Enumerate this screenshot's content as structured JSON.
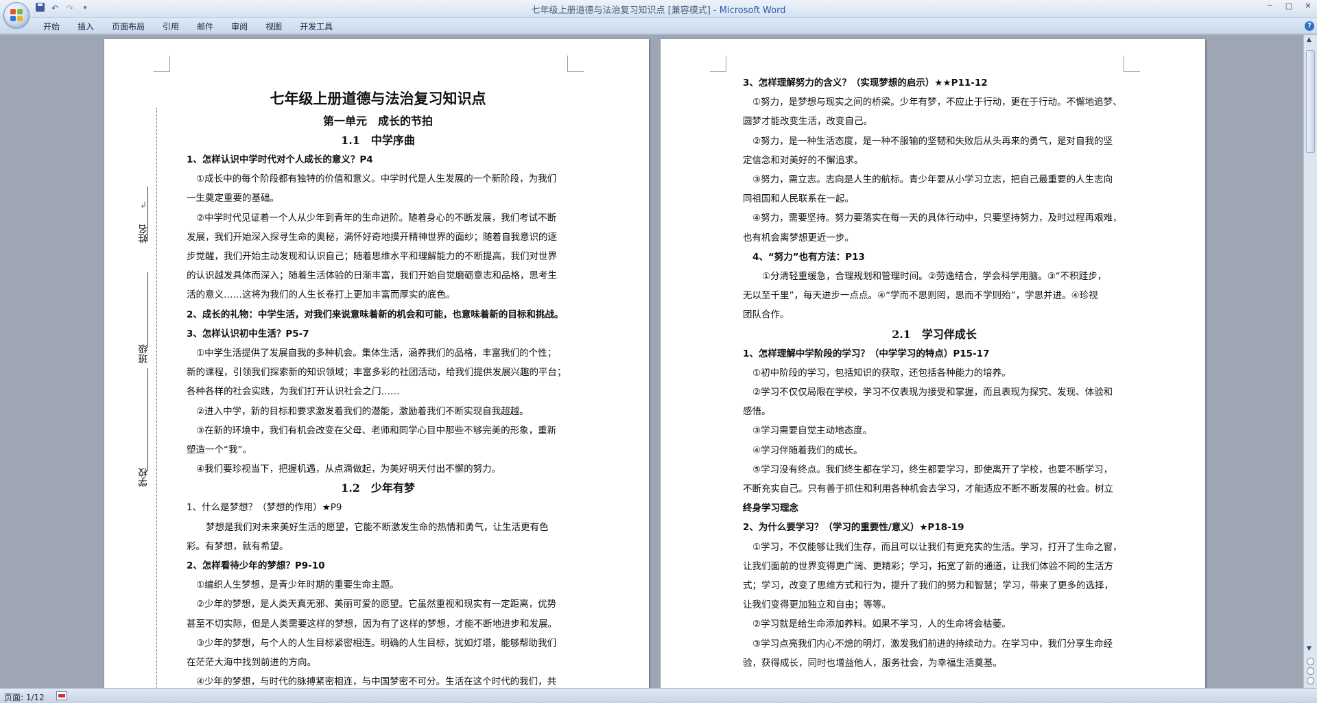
{
  "window": {
    "title": "七年级上册道德与法治复习知识点 [兼容模式] - ",
    "app_name": "Microsoft Word"
  },
  "qat": {
    "icons": [
      "save-icon",
      "undo-icon",
      "redo-icon",
      "customize-icon"
    ]
  },
  "ribbon": {
    "tabs": [
      "开始",
      "插入",
      "页面布局",
      "引用",
      "邮件",
      "审阅",
      "视图",
      "开发工具"
    ]
  },
  "page1": {
    "title": "七年级上册道德与法治复习知识点",
    "unit": "第一单元　成长的节拍",
    "sec1": "1.1　中学序曲",
    "lines1": [
      "1、怎样认识中学时代对个人成长的意义？P4",
      "①成长中的每个阶段都有独特的价值和意义。中学时代是人生发展的一个新阶段，为我们",
      "一生奠定重要的基础。",
      "②中学时代见证着一个人从少年到青年的生命进阶。随着身心的不断发展，我们考试不断",
      "发展，我们开始深入探寻生命的奥秘，满怀好奇地摸开精神世界的面纱；随着自我意识的逐",
      "步觉醒，我们开始主动发现和认识自己；随着思维水平和理解能力的不断提高，我们对世界",
      "的认识越发具体而深入；随着生活体验的日渐丰富，我们开始自觉磨砺意志和品格，思考生",
      "活的意义……这将为我们的人生长卷打上更加丰富而厚实的底色。",
      "2、成长的礼物：中学生活，对我们来说意味着新的机会和可能，也意味着新的目标和挑战。",
      "3、怎样认识初中生活？P5-7",
      "①中学生活提供了发展自我的多种机会。集体生活，涵养我们的品格，丰富我们的个性；",
      "新的课程，引领我们探索新的知识领域；丰富多彩的社团活动，给我们提供发展兴趣的平台；",
      "各种各样的社会实践，为我们打开认识社会之门……",
      "②进入中学，新的目标和要求激发着我们的潜能，激励着我们不断实现自我超越。",
      "③在新的环境中，我们有机会改变在父母、老师和同学心目中那些不够完美的形象，重新",
      "塑造一个“我”。",
      "④我们要珍视当下，把握机遇，从点滴做起，为美好明天付出不懈的努力。"
    ],
    "sec2": "1.2　少年有梦",
    "lines2": [
      "1、什么是梦想？（梦想的作用）★P9",
      "梦想是我们对未来美好生活的愿望，它能不断激发生命的热情和勇气，让生活更有色",
      "彩。有梦想，就有希望。",
      "2、怎样看待少年的梦想？P9-10",
      "①编织人生梦想，是青少年时期的重要生命主题。",
      "②少年的梦想，是人类天真无邪、美丽可爱的愿望。它虽然重视和现实有一定距离，优势",
      "甚至不切实际，但是人类需要这样的梦想，因为有了这样的梦想，才能不断地进步和发展。",
      "③少年的梦想，与个人的人生目标紧密相连。明确的人生目标，犹如灯塔，能够帮助我们",
      "在茫茫大海中找到前进的方向。",
      "④少年的梦想，与时代的脉搏紧密相连，与中国梦密不可分。生活在这个时代的我们，共"
    ],
    "binding": {
      "name": "姓名",
      "class": "班级",
      "school": "学校"
    }
  },
  "page2": {
    "lines1": [
      "3、怎样理解努力的含义？（实现梦想的启示）★★P11-12",
      "①努力，是梦想与现实之间的桥梁。少年有梦，不应止于行动，更在于行动。不懈地追梦、",
      "圆梦才能改变生活，改变自己。",
      "②努力，是一种生活态度，是一种不服输的坚韧和失败后从头再来的勇气，是对自我的坚",
      "定信念和对美好的不懈追求。",
      "③努力，需立志。志向是人生的航标。青少年要从小学习立志，把自己最重要的人生志向",
      "同祖国和人民联系在一起。",
      "④努力，需要坚持。努力要落实在每一天的具体行动中，只要坚持努力，及时过程再艰难，",
      "也有机会离梦想更近一步。",
      "4、“努力”也有方法：P13",
      "①分清轻重缓急，合理规划和管理时间。②劳逸结合，学会科学用脑。③“不积跬步，",
      "无以至千里”，每天进步一点点。④“学而不思则罔，思而不学则殆”，学思并进。④珍视",
      "团队合作。"
    ],
    "sec": "2.1　学习伴成长",
    "lines2": [
      "1、怎样理解中学阶段的学习？（中学学习的特点）P15-17",
      "①初中阶段的学习，包括知识的获取，还包括各种能力的培养。",
      "②学习不仅仅局限在学校，学习不仅表现为接受和掌握，而且表现为探究、发现、体验和",
      "感悟。",
      "③学习需要自觉主动地态度。",
      "④学习伴随着我们的成长。",
      "⑤学习没有终点。我们终生都在学习，终生都要学习，即使离开了学校，也要不断学习，",
      "不断充实自己。只有善于抓住和利用各种机会去学习，才能适应不断不断发展的社会。树立",
      "终身学习理念",
      "2、为什么要学习？（学习的重要性/意义）★P18-19",
      "①学习，不仅能够让我们生存，而且可以让我们有更充实的生活。学习，打开了生命之窗，",
      "让我们面前的世界变得更广阔、更精彩；学习，拓宽了新的通道，让我们体验不同的生活方",
      "式；学习，改变了思维方式和行为，提升了我们的努力和智慧；学习，带来了更多的选择，",
      "让我们变得更加独立和自由；等等。",
      "②学习就是给生命添加养料。如果不学习，人的生命将会枯萎。",
      "③学习点亮我们内心不熄的明灯，激发我们前进的持续动力。在学习中，我们分享生命经",
      "验，获得成长，同时也增益他人，服务社会，为幸福生活奠基。"
    ]
  },
  "status": {
    "page": "页面: 1/12"
  }
}
